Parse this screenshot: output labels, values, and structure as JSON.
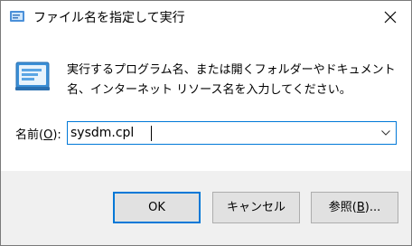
{
  "window": {
    "title": "ファイル名を指定して実行"
  },
  "body": {
    "description": "実行するプログラム名、または開くフォルダーやドキュメント名、インターネット リソース名を入力してください。",
    "name_label_prefix": "名前(",
    "name_label_access": "O",
    "name_label_suffix": "):",
    "input_value": "sysdm.cpl"
  },
  "buttons": {
    "ok": "OK",
    "cancel": "キャンセル",
    "browse_prefix": "参照(",
    "browse_access": "B",
    "browse_suffix": ")..."
  },
  "icons": {
    "title_icon": "run-icon",
    "app_icon": "run-dialog-icon",
    "close_icon": "close-icon",
    "dropdown_icon": "chevron-down-icon"
  },
  "colors": {
    "accent": "#0078d7",
    "footer_bg": "#f0f0f0",
    "button_bg": "#e1e1e1"
  }
}
